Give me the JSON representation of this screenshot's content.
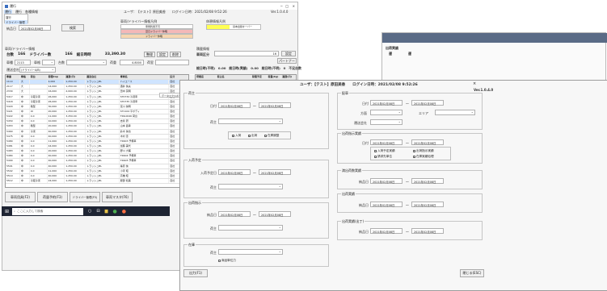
{
  "main": {
    "app_title": "運行",
    "header": "ユーザ：【テスト】原田美香　　ログイン日時：2021/02/08 9:52:26",
    "version": "Ver.1.0.4.0",
    "menu": [
      "運行",
      "運行",
      "各種情報"
    ],
    "dropdown_items": [
      "運行",
      "ドライバー管理"
    ],
    "unit_label": "納品日",
    "unit_date": "2021年02月08日",
    "search_button": "検索",
    "vehicle_panel_title": "車両/ドライバー情報凡例",
    "vehicle_legend": [
      "車両利用不可",
      "翌日ドライバー休暇",
      "ドライバー休暇"
    ],
    "vehicle_legend_colors": [
      "#ffffff",
      "#f4b8b8",
      "#f7d7b0"
    ],
    "office_panel_title": "休憩情報凡例",
    "office_legend": [
      "基本出勤オーバー"
    ],
    "office_legend_color": "#ffff55",
    "driver_section": "車両/ドライバー情報",
    "driver_stats": [
      "台数",
      "166",
      "ドライバー数",
      "166",
      "総日時時",
      "33,390.30"
    ],
    "driver_buttons": [
      "整理",
      "設定",
      "削除"
    ],
    "filter_labels": [
      "車種",
      "車格",
      "台数",
      "荷重",
      "荷室"
    ],
    "filter_values": [
      "2113",
      "4.8000"
    ],
    "filter_sub": [
      "運送会社",
      "(ドライバーA/B)"
    ],
    "right_section": "積載情報",
    "vehicle_label": "車両区分",
    "vehicle_value": "16",
    "settings_button": "設定",
    "partner_button": "パートナー",
    "right_stats": "総日時(不明)　0.00　総日時(実績)　0.00　総日時(不明)　0　不足台数",
    "table_headers": [
      "車番",
      "車格",
      "荷台",
      "荷積Cap",
      "運賃(円)",
      "運送会社",
      "車両名",
      "区分"
    ],
    "table_rows": [
      [
        "1110",
        "大",
        "",
        "4,000",
        "1,250.00",
        "トラッシュBL",
        "ハイエース",
        "自社"
      ],
      [
        "2117",
        "大",
        "",
        "14,000",
        "1,250.00",
        "トラッシュBL",
        "酒井 信夫",
        "自社"
      ],
      [
        "2330",
        "大",
        "",
        "16,000",
        "2,000.00",
        "トラッシュBL",
        "田中 英明",
        "自社"
      ],
      [
        "5417",
        "中",
        "冷蔵冷凍",
        "26,000",
        "1,250.00",
        "トラッシュBL",
        "ST0734 冷凍車",
        "自社"
      ],
      [
        "5418",
        "中",
        "冷蔵冷凍",
        "26,000",
        "1,250.00",
        "トラッシュBL",
        "ST0735 冷凍車",
        "自社"
      ],
      [
        "5420",
        "中",
        "箱型",
        "30,000",
        "1,250.00",
        "トラッシュBL",
        "富川 信明",
        "自社"
      ],
      [
        "5421",
        "中",
        "4t",
        "20,000",
        "1,250.00",
        "トラッシュBL",
        "ST1104 平ボディ",
        "自社"
      ],
      [
        "5422",
        "中",
        "4.0",
        "11,000",
        "3,250.00",
        "トラッシュBL",
        "TRK-0046 荷台",
        "自社"
      ],
      [
        "5450",
        "中",
        "4.0",
        "10,000",
        "1,250.00",
        "トラッシュBL",
        "吉永 研",
        "自社"
      ],
      [
        "5453",
        "中",
        "箱型",
        "20,000",
        "1,250.00",
        "トラッシュBL",
        "山本 昌幸",
        "自社"
      ],
      [
        "5460",
        "中",
        "冷凍",
        "40,000",
        "1,250.00",
        "トラッシュBL",
        "鈴木 信也",
        "自社"
      ],
      [
        "5475",
        "中",
        "4.0",
        "40,000",
        "1,250.00",
        "トラッシュBL",
        "木村 恵",
        "自社"
      ],
      [
        "5480",
        "中",
        "4.0",
        "11,000",
        "1,250.00",
        "トラッシュBL",
        "TRK03 予備車",
        "自社"
      ],
      [
        "5481",
        "中",
        "4.0",
        "44,000",
        "1,250.00",
        "トラッシュBL",
        "加藤 美代",
        "自社"
      ],
      [
        "5483",
        "中",
        "4.0",
        "20,000",
        "1,250.00",
        "トラッシュBL",
        "野川 大輔",
        "自社"
      ],
      [
        "5484",
        "中",
        "4.0",
        "40,000",
        "1,250.00",
        "トラッシュBL",
        "TRK04 予備車",
        "自社"
      ],
      [
        "5490",
        "中",
        "4.0",
        "40,000",
        "1,250.00",
        "トラッシュBL",
        "TRK05 予備車",
        "自社"
      ],
      [
        "5501",
        "中",
        "4.0",
        "40,000",
        "1,250.00",
        "トラッシュBL",
        "篠原 信",
        "自社"
      ],
      [
        "5502",
        "中",
        "4.0",
        "11,000",
        "1,250.00",
        "トラッシュBL",
        "小寺 昭",
        "自社"
      ],
      [
        "5510",
        "中",
        "4.0",
        "40,000",
        "1,250.00",
        "トラッシュBL",
        "高橋 昭",
        "自社"
      ],
      [
        "5512",
        "中",
        "冷蔵冷凍",
        "24,000",
        "1,250.00",
        "トラッシュBL",
        "服部 和美",
        "自社"
      ]
    ],
    "context_menu": [
      "データエクスポート"
    ],
    "right_table_headers": [
      "発着店",
      "荷主名",
      "荷積予定",
      "荷量(kg)",
      "運賃(円)"
    ],
    "right_table_rows": [
      [
        "東京-屋下",
        "",
        "0,000",
        "",
        ""
      ],
      [
        "東京店",
        "",
        "0,000",
        "",
        ""
      ],
      [
        "札幌店",
        "",
        "0,000",
        "",
        ""
      ]
    ],
    "tabs": [
      "車両用具(F2)",
      "荷量予約(F3)",
      "ドライバー管理(F5)",
      "車両マスタ(F6)"
    ],
    "taskbar_search": "ここに入力して検索"
  },
  "dialog": {
    "header": "ユーザ：【テスト】原田美香　　ログイン日時：2021/02/08 9:52:26",
    "version": "Ver.1.0.4.0",
    "left": {
      "group1": {
        "title": "荷主",
        "date_label": "日付",
        "date_from": "2021年02月08日",
        "range_sep": "〜",
        "date_to": "2021年02月08日",
        "shipper_label": "荷主",
        "checks": [
          "入荷",
          "出荷",
          "在庫調整"
        ]
      },
      "group2": {
        "title": "入荷予定",
        "date_label": "入荷予定日",
        "date_from": "2021年02月08日",
        "range_sep": "〜",
        "date_to": "2021年02月08日",
        "shipper_label": "荷主"
      },
      "group3": {
        "title": "出荷指示",
        "date_label": "納品日",
        "date_from": "2021年02月08日",
        "range_sep": "〜",
        "date_to": "2021年02月08日",
        "shipper_label": "荷主"
      },
      "group4": {
        "title": "在庫",
        "shipper_label": "荷主",
        "check": "商品単位力"
      }
    },
    "right": {
      "group1": {
        "title": "配車",
        "date_label": "日付",
        "date_from": "2021年02月08日",
        "range_sep": "〜",
        "date_to": "2021年02月08日",
        "dept_label": "方面",
        "area_label": "エリア",
        "carrier_label": "運送会社"
      },
      "group2": {
        "title": "出荷指示実績",
        "date_label": "日付",
        "date_from": "2021年02月08日",
        "range_sep": "〜",
        "date_to": "2021年02月08日",
        "checks": [
          "入荷予定実績",
          "出荷指示実績",
          "請求先単位",
          "在庫実績処理"
        ]
      },
      "group3": {
        "title": "満出荷数実績",
        "date_label": "納品日",
        "date_from": "2021年02月08日",
        "range_sep": "〜",
        "date_to": "2021年02月08日"
      },
      "group4": {
        "title": "出荷実績",
        "date_label": "納品日",
        "date_from": "2021年02月08日",
        "range_sep": "〜",
        "date_to": "2021年02月08日"
      },
      "group5": {
        "title": "出荷実績(出丁)",
        "date_label": "納品日",
        "date_from": "2021年02月08日",
        "range_sep": "〜",
        "date_to": "2021年02月08日"
      }
    },
    "output_button": "出力(F1)",
    "close_button": "閉じる(ESC)"
  },
  "background_window": {
    "title": "出荷実績",
    "menu": [
      "運",
      "運"
    ]
  }
}
